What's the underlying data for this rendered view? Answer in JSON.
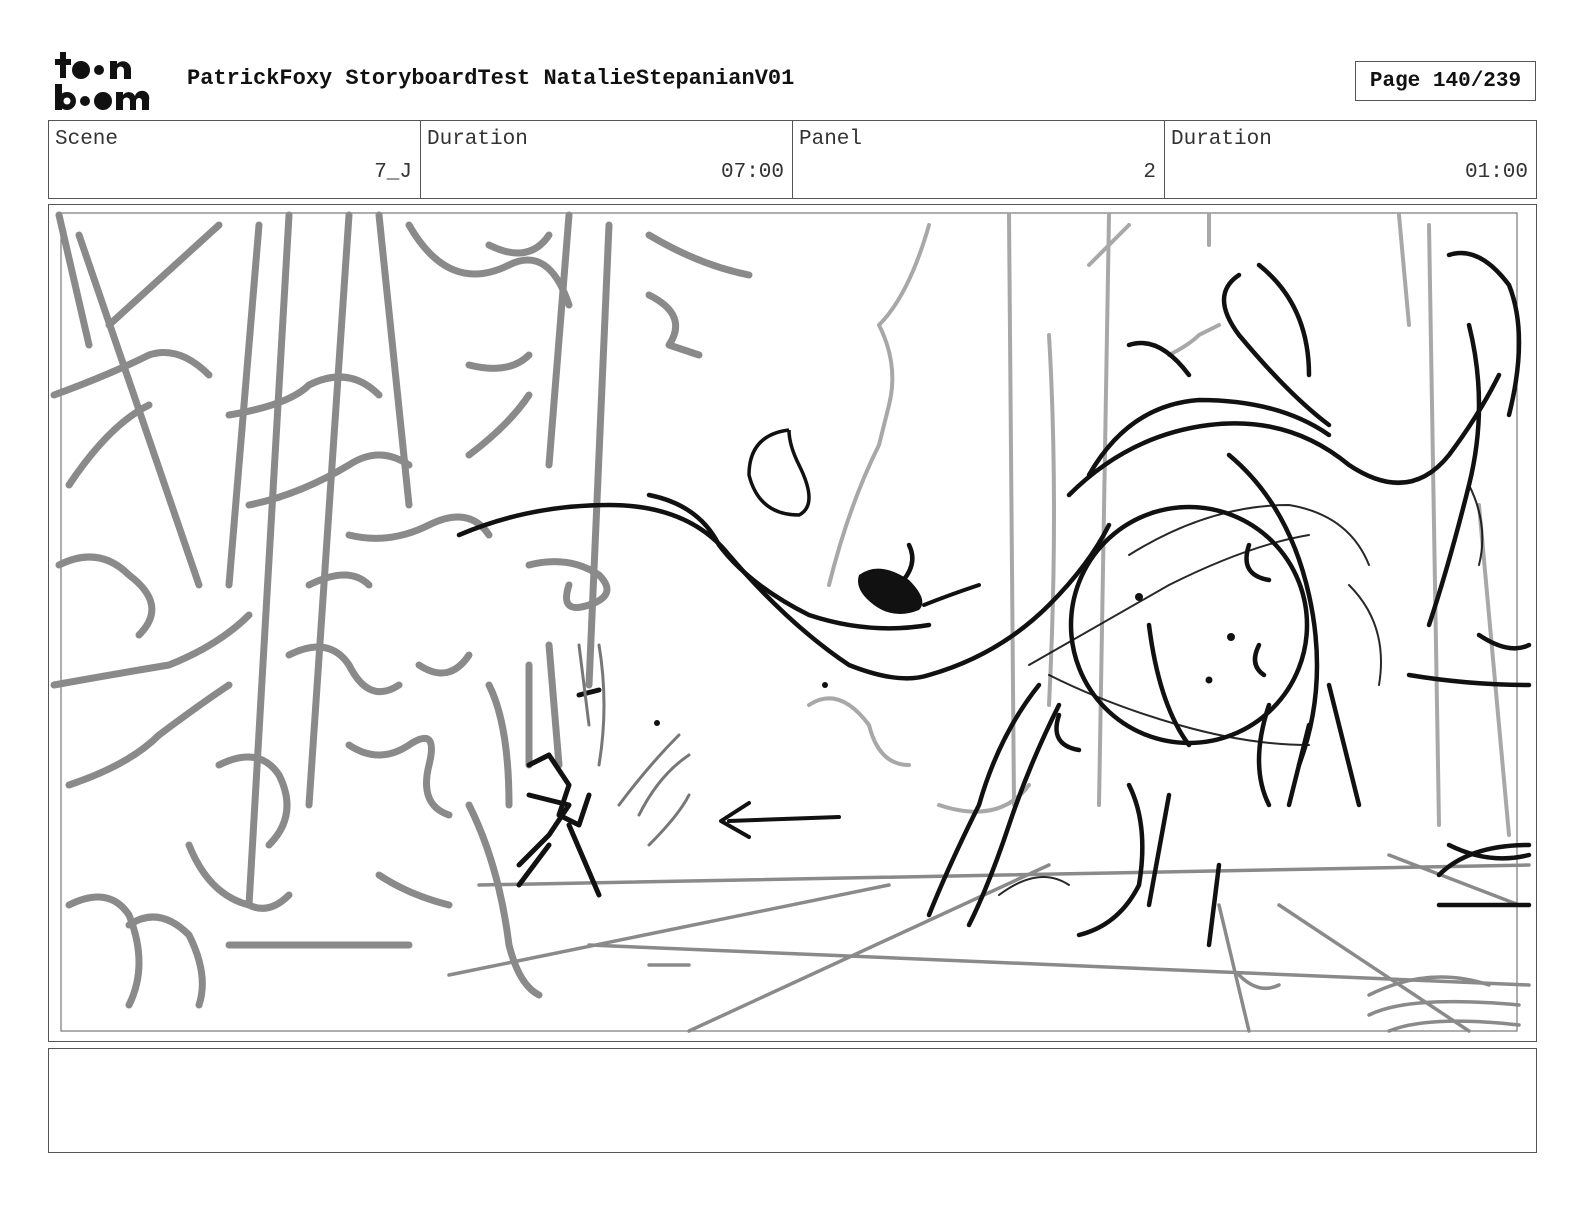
{
  "logo": {
    "line1": "toon",
    "line2": "boom",
    "icon": "toon-boom-logo"
  },
  "header": {
    "title": "PatrickFoxy StoryboardTest NatalieStepanianV01",
    "page": "Page 140/239"
  },
  "info": {
    "scene_label": "Scene",
    "scene_value": "7_J",
    "scene_duration_label": "Duration",
    "scene_duration_value": "07:00",
    "panel_label": "Panel",
    "panel_value": "2",
    "panel_duration_label": "Duration",
    "panel_duration_value": "01:00"
  },
  "panel_image": {
    "icon": "storyboard-sketch"
  },
  "notes": {
    "text": ""
  }
}
